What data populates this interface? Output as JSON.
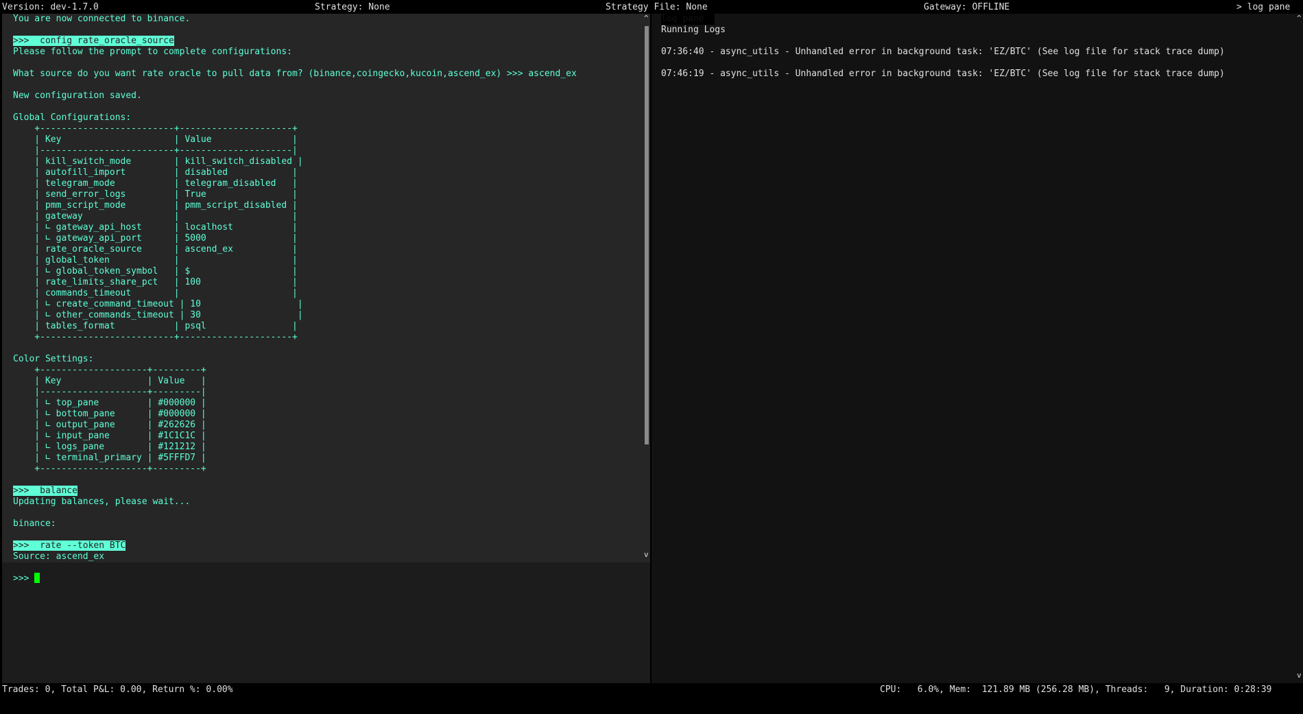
{
  "top_bar": {
    "version": "Version: dev-1.7.0",
    "strategy": "Strategy: None",
    "strategy_file": "Strategy File: None",
    "gateway": "Gateway: OFFLINE",
    "log_pane_toggle": "> log pane"
  },
  "output": {
    "lines": [
      {
        "text": "You are now connected to binance."
      },
      {
        "text": ""
      },
      {
        "text": ">>>  config rate_oracle_source",
        "cmd": true
      },
      {
        "text": "Please follow the prompt to complete configurations:"
      },
      {
        "text": ""
      },
      {
        "text": "What source do you want rate oracle to pull data from? (binance,coingecko,kucoin,ascend_ex) >>> ascend_ex"
      },
      {
        "text": ""
      },
      {
        "text": "New configuration saved."
      },
      {
        "text": ""
      },
      {
        "text": "Global Configurations:"
      },
      {
        "text": "    +-------------------------+---------------------+"
      },
      {
        "text": "    | Key                     | Value               |"
      },
      {
        "text": "    |-------------------------+---------------------|"
      },
      {
        "text": "    | kill_switch_mode        | kill_switch_disabled |"
      },
      {
        "text": "    | autofill_import         | disabled            |"
      },
      {
        "text": "    | telegram_mode           | telegram_disabled   |"
      },
      {
        "text": "    | send_error_logs         | True                |"
      },
      {
        "text": "    | pmm_script_mode         | pmm_script_disabled |"
      },
      {
        "text": "    | gateway                 |                     |"
      },
      {
        "text": "    | ∟ gateway_api_host      | localhost           |"
      },
      {
        "text": "    | ∟ gateway_api_port      | 5000                |"
      },
      {
        "text": "    | rate_oracle_source      | ascend_ex           |"
      },
      {
        "text": "    | global_token            |                     |"
      },
      {
        "text": "    | ∟ global_token_symbol   | $                   |"
      },
      {
        "text": "    | rate_limits_share_pct   | 100                 |"
      },
      {
        "text": "    | commands_timeout        |                     |"
      },
      {
        "text": "    | ∟ create_command_timeout | 10                  |"
      },
      {
        "text": "    | ∟ other_commands_timeout | 30                  |"
      },
      {
        "text": "    | tables_format           | psql                |"
      },
      {
        "text": "    +-------------------------+---------------------+"
      },
      {
        "text": ""
      },
      {
        "text": "Color Settings:"
      },
      {
        "text": "    +--------------------+---------+"
      },
      {
        "text": "    | Key                | Value   |"
      },
      {
        "text": "    |--------------------+---------|"
      },
      {
        "text": "    | ∟ top_pane         | #000000 |"
      },
      {
        "text": "    | ∟ bottom_pane      | #000000 |"
      },
      {
        "text": "    | ∟ output_pane      | #262626 |"
      },
      {
        "text": "    | ∟ input_pane       | #1C1C1C |"
      },
      {
        "text": "    | ∟ logs_pane        | #121212 |"
      },
      {
        "text": "    | ∟ terminal_primary | #5FFFD7 |"
      },
      {
        "text": "    +--------------------+---------+"
      },
      {
        "text": ""
      },
      {
        "text": ">>>  balance",
        "cmd": true
      },
      {
        "text": "Updating balances, please wait..."
      },
      {
        "text": ""
      },
      {
        "text": "binance:"
      },
      {
        "text": ""
      },
      {
        "text": ">>>  rate --token BTC",
        "cmd": true
      },
      {
        "text": "Source: ascend_ex"
      }
    ]
  },
  "input": {
    "prompt": ">>> "
  },
  "logs": {
    "tab_label": "log_pane",
    "lines": [
      "Running Logs",
      "",
      "07:36:40 - async_utils - Unhandled error in background task: 'EZ/BTC' (See log file for stack trace dump)",
      "",
      "07:46:19 - async_utils - Unhandled error in background task: 'EZ/BTC' (See log file for stack trace dump)"
    ]
  },
  "bottom_bar": {
    "trades": "Trades: 0, Total P&L: 0.00, Return %: 0.00%",
    "system": "CPU:   6.0%, Mem:  121.89 MB (256.28 MB), Threads:   9, Duration: 0:28:39"
  },
  "scroll_arrows": {
    "up": "^",
    "down": "v"
  }
}
